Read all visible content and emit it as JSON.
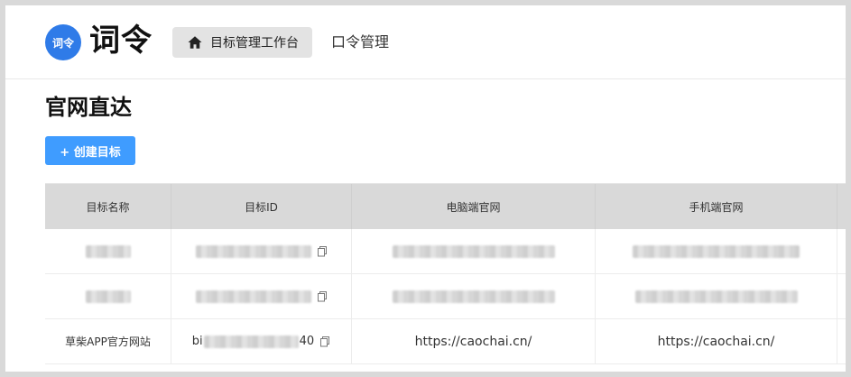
{
  "header": {
    "logo_badge": "词令",
    "logo_text": "词令",
    "nav": [
      {
        "label": "目标管理工作台",
        "icon": "home-icon",
        "active": true
      },
      {
        "label": "口令管理",
        "active": false
      }
    ]
  },
  "page": {
    "title": "官网直达",
    "create_button": "+ 创建目标"
  },
  "table": {
    "columns": [
      "目标名称",
      "目标ID",
      "电脑端官网",
      "手机端官网"
    ],
    "rows": [
      {
        "name": "",
        "id": "",
        "pc": "",
        "mobile": "",
        "redacted": true
      },
      {
        "name": "",
        "id": "",
        "pc": "",
        "mobile": "",
        "redacted": true
      },
      {
        "name": "草柴APP官方网站",
        "id_prefix": "bi",
        "id_suffix": "40",
        "pc": "https://caochai.cn/",
        "mobile": "https://caochai.cn/",
        "redacted": false
      }
    ]
  },
  "colors": {
    "accent": "#3f9cff",
    "logo": "#2f7be8",
    "header_bg": "#d9d9d9"
  }
}
